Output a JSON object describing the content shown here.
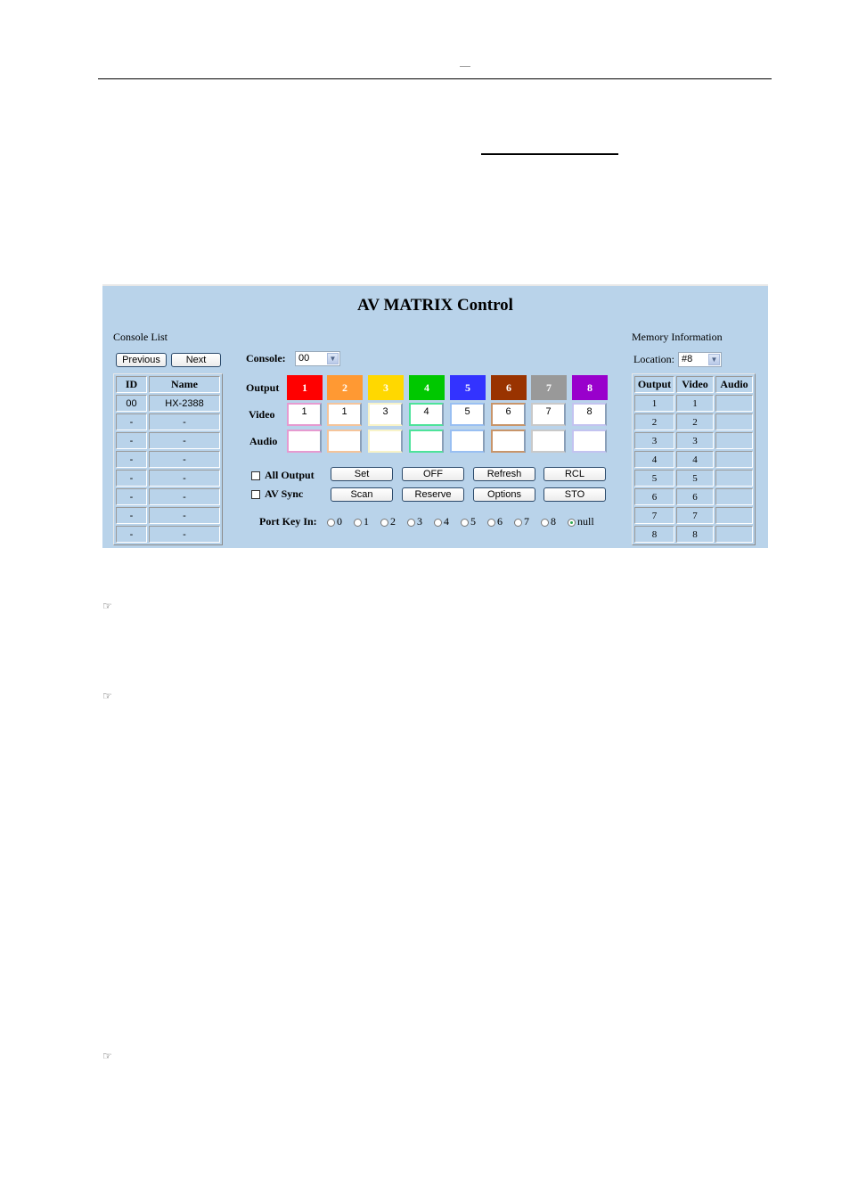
{
  "document": {
    "header_mark": "—",
    "note_icon": "pointing-hand-icon"
  },
  "panel": {
    "title": "AV MATRIX Control",
    "console_list": {
      "label": "Console List",
      "previous_label": "Previous",
      "next_label": "Next",
      "columns": [
        "ID",
        "Name"
      ],
      "rows": [
        {
          "id": "00",
          "name": "HX-2388"
        },
        {
          "id": "-",
          "name": "-"
        },
        {
          "id": "-",
          "name": "-"
        },
        {
          "id": "-",
          "name": "-"
        },
        {
          "id": "-",
          "name": "-"
        },
        {
          "id": "-",
          "name": "-"
        },
        {
          "id": "-",
          "name": "-"
        },
        {
          "id": "-",
          "name": "-"
        }
      ]
    },
    "console": {
      "label": "Console:",
      "selected": "00"
    },
    "matrix": {
      "output_label": "Output",
      "video_label": "Video",
      "audio_label": "Audio",
      "outputs": [
        {
          "label": "1",
          "color": "#ff0000",
          "border": "#e69ad0",
          "video": "1",
          "audio": ""
        },
        {
          "label": "2",
          "color": "#ff9933",
          "border": "#f5c49a",
          "video": "1",
          "audio": ""
        },
        {
          "label": "3",
          "color": "#ffd800",
          "border": "#f8f3c8",
          "video": "3",
          "audio": ""
        },
        {
          "label": "4",
          "color": "#00c800",
          "border": "#4de39a",
          "video": "4",
          "audio": ""
        },
        {
          "label": "5",
          "color": "#3333ff",
          "border": "#99bff2",
          "video": "5",
          "audio": ""
        },
        {
          "label": "6",
          "color": "#993300",
          "border": "#c8956a",
          "video": "6",
          "audio": ""
        },
        {
          "label": "7",
          "color": "#999999",
          "border": "#c9c9c9",
          "video": "7",
          "audio": ""
        },
        {
          "label": "8",
          "color": "#9900cc",
          "border": "#c3c3f0",
          "video": "8",
          "audio": ""
        }
      ]
    },
    "options": {
      "all_output_label": "All Output",
      "all_output_checked": false,
      "av_sync_label": "AV Sync",
      "av_sync_checked": false
    },
    "buttons": {
      "set": "Set",
      "off": "OFF",
      "refresh": "Refresh",
      "rcl": "RCL",
      "scan": "Scan",
      "reserve": "Reserve",
      "options": "Options",
      "sto": "STO"
    },
    "port_key_in": {
      "label": "Port Key In:",
      "options": [
        "0",
        "1",
        "2",
        "3",
        "4",
        "5",
        "6",
        "7",
        "8",
        "null"
      ],
      "selected": "null"
    },
    "memory": {
      "label": "Memory Information",
      "location_label": "Location:",
      "location_selected": "#8",
      "columns": [
        "Output",
        "Video",
        "Audio"
      ],
      "rows": [
        {
          "output": "1",
          "video": "1",
          "audio": ""
        },
        {
          "output": "2",
          "video": "2",
          "audio": ""
        },
        {
          "output": "3",
          "video": "3",
          "audio": ""
        },
        {
          "output": "4",
          "video": "4",
          "audio": ""
        },
        {
          "output": "5",
          "video": "5",
          "audio": ""
        },
        {
          "output": "6",
          "video": "6",
          "audio": ""
        },
        {
          "output": "7",
          "video": "7",
          "audio": ""
        },
        {
          "output": "8",
          "video": "8",
          "audio": ""
        }
      ]
    }
  }
}
